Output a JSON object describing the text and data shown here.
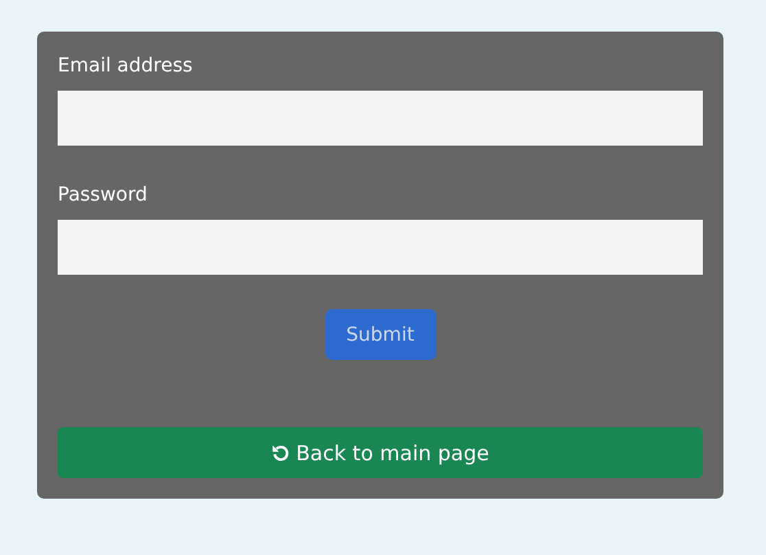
{
  "form": {
    "fields": [
      {
        "label": "Email address"
      },
      {
        "label": "Password"
      }
    ],
    "submit": {
      "label": "Submit"
    },
    "back": {
      "label": "Back to main page"
    }
  }
}
